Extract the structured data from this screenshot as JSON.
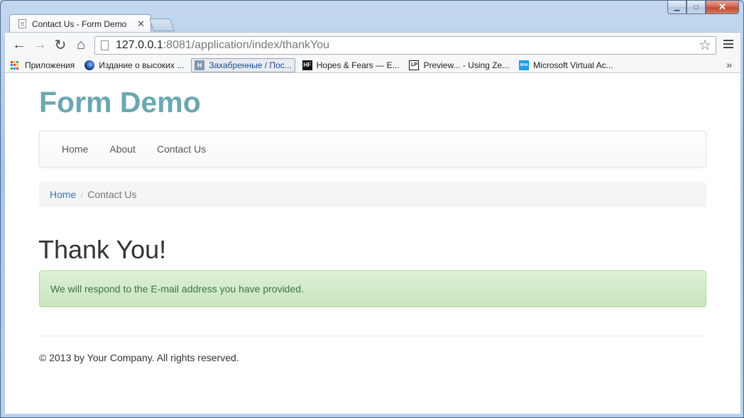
{
  "browser": {
    "tab_title": "Contact Us - Form Demo",
    "tab_close": "✕",
    "url_host": "127.0.0.1",
    "url_path": ":8081/application/index/thankYou",
    "star": "☆",
    "back": "←",
    "forward": "→",
    "reload": "↻",
    "home": "⌂",
    "window_minimize": "▁",
    "window_maximize": "□",
    "window_close": "✕"
  },
  "bookmarks": {
    "items": [
      {
        "label": "Приложения",
        "icon": "apps-grid-icon"
      },
      {
        "label": "Издание о высоких ...",
        "icon": "circle-logo-icon"
      },
      {
        "label": "Захабренные / Пос...",
        "icon": "h-logo-icon",
        "icon_text": "H"
      },
      {
        "label": "Hopes & Fears — E...",
        "icon": "hf-logo-icon",
        "icon_text": "HF"
      },
      {
        "label": "Preview... - Using Ze...",
        "icon": "lp-logo-icon",
        "icon_text": "LP"
      },
      {
        "label": "Microsoft Virtual Ac...",
        "icon": "mva-logo-icon",
        "icon_text": "MVA"
      }
    ],
    "more": "»"
  },
  "site": {
    "brand": "Form Demo",
    "nav": [
      "Home",
      "About",
      "Contact Us"
    ],
    "breadcrumb": {
      "home": "Home",
      "separator": "/",
      "current": "Contact Us"
    },
    "heading": "Thank You!",
    "alert": "We will respond to the E-mail address you have provided.",
    "footer": "© 2013 by Your Company. All rights reserved."
  },
  "colors": {
    "brand": "#6aa8af",
    "link": "#337ab7",
    "alert_text": "#3c763d",
    "alert_bg": "#dff0d8"
  }
}
